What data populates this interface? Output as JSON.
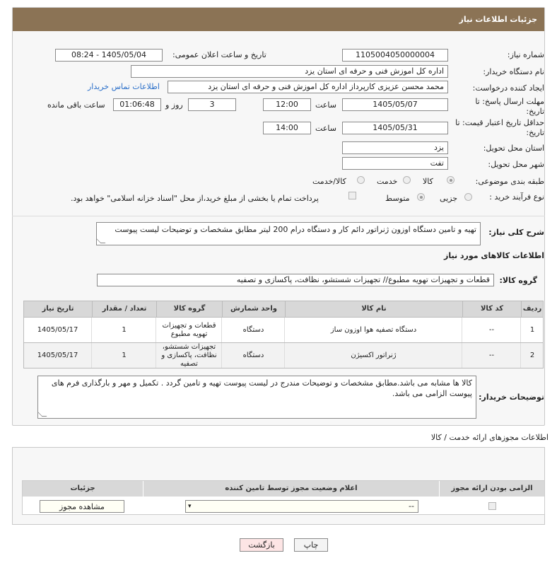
{
  "header": {
    "title": "جزئیات اطلاعات نیاز"
  },
  "fields": {
    "need_number_label": "شماره نیاز:",
    "need_number": "1105004050000004",
    "announce_label": "تاریخ و ساعت اعلان عمومی:",
    "announce_value": "1405/05/04 - 08:24",
    "buyer_org_label": "نام دستگاه خریدار:",
    "buyer_org": "اداره کل اموزش فنی و حرفه ای استان یزد",
    "creator_label": "ایجاد کننده درخواست:",
    "creator": "محمد محسن عزیزی کارپرداز اداره کل اموزش فنی و حرفه ای استان یزد",
    "contact_link": "اطلاعات تماس خریدار",
    "deadline_label": "مهلت ارسال پاسخ: تا تاریخ:",
    "deadline_date": "1405/05/07",
    "time_label": "ساعت",
    "deadline_time": "12:00",
    "days_value": "3",
    "days_label": "روز و",
    "remaining_time": "01:06:48",
    "remaining_label": "ساعت باقی مانده",
    "validity_label": "حداقل تاریخ اعتبار قیمت: تا تاریخ:",
    "validity_date": "1405/05/31",
    "validity_time": "14:00",
    "province_label": "استان محل تحویل:",
    "province": "یزد",
    "city_label": "شهر محل تحویل:",
    "city": "تفت",
    "category_label": "طبقه بندی موضوعی:",
    "category_options": [
      "کالا",
      "خدمت",
      "کالا/خدمت"
    ],
    "process_label": "نوع فرآیند خرید :",
    "process_options": [
      "جزیی",
      "متوسط"
    ],
    "payment_text": "پرداخت تمام یا بخشی از مبلغ خرید،از محل \"اسناد خزانه اسلامی\" خواهد بود."
  },
  "description": {
    "label": "شرح کلی نیاز:",
    "text": "تهیه و تامین دستگاه اوزون ژنراتور دائم کار و دستگاه درام 200 لیتر مطابق مشخصات و توضیحات لیست پیوست"
  },
  "goods": {
    "section_title": "اطلاعات کالاهای مورد نیاز",
    "group_label": "گروه کالا:",
    "group_value": "قطعات و تجهیزات تهویه مطبوع// تجهیزات شستشو، نظافت، پاکسازی و تصفیه",
    "columns": [
      "ردیف",
      "کد کالا",
      "نام کالا",
      "واحد شمارش",
      "گروه کالا",
      "تعداد / مقدار",
      "تاریخ نیاز"
    ],
    "rows": [
      {
        "index": "1",
        "code": "--",
        "name": "دستگاه تصفیه هوا اوزون ساز",
        "unit": "دستگاه",
        "group": "قطعات و تجهیزات تهویه مطبوع",
        "qty": "1",
        "date": "1405/05/17"
      },
      {
        "index": "2",
        "code": "--",
        "name": "ژنراتور اکسیژن",
        "unit": "دستگاه",
        "group": "تجهیزات شستشو، نظافت، پاکسازی و تصفیه",
        "qty": "1",
        "date": "1405/05/17"
      }
    ]
  },
  "buyer_notes": {
    "label": "توضیحات خریدار:",
    "text": "کالا ها مشابه می باشد.مطابق مشخصات و توضیحات مندرج در لیست پیوست تهیه و تامین گردد . تکمیل و مهر و بارگذاری فرم های پیوست الزامی می باشد."
  },
  "permits": {
    "section_title": "اطلاعات مجوزهای ارائه خدمت / کالا",
    "columns": [
      "الزامی بودن ارائه مجوز",
      "اعلام وضعیت مجوز توسط تامین کننده",
      "جزئیات"
    ],
    "select_value": "--",
    "view_button": "مشاهده مجوز"
  },
  "buttons": {
    "print": "چاپ",
    "back": "بازگشت"
  }
}
